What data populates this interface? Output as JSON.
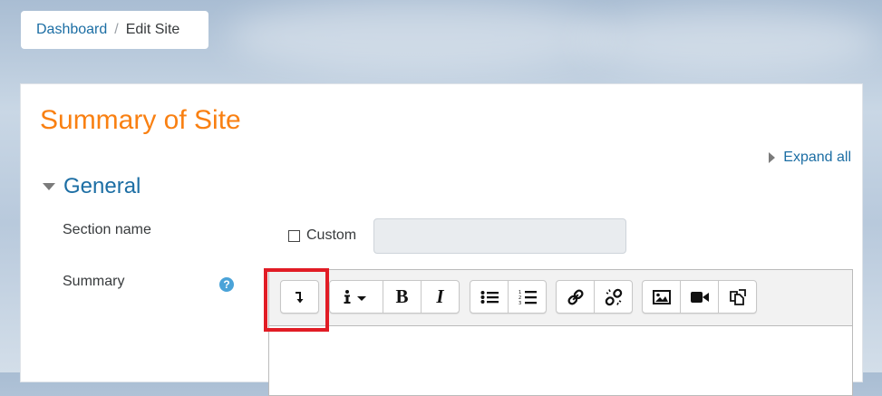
{
  "breadcrumb": {
    "home": "Dashboard",
    "separator": "/",
    "current": "Edit Site"
  },
  "page": {
    "title": "Summary of Site",
    "expand_all": "Expand all"
  },
  "section": {
    "title": "General"
  },
  "form": {
    "section_name_label": "Section name",
    "custom_label": "Custom",
    "section_name_value": "",
    "summary_label": "Summary",
    "help_glyph": "?"
  },
  "toolbar": {
    "groups": [
      [
        "collapse-toolbar-icon"
      ],
      [
        "info-style-icon",
        "bold-icon",
        "italic-icon"
      ],
      [
        "unordered-list-icon",
        "ordered-list-icon"
      ],
      [
        "link-icon",
        "unlink-icon"
      ],
      [
        "image-icon",
        "video-icon",
        "manage-files-icon"
      ]
    ],
    "bold_glyph": "B",
    "italic_glyph": "I"
  },
  "colors": {
    "title": "#f98012",
    "link": "#1c6ea4",
    "highlight": "#e11c25",
    "help": "#4aa3d8"
  }
}
